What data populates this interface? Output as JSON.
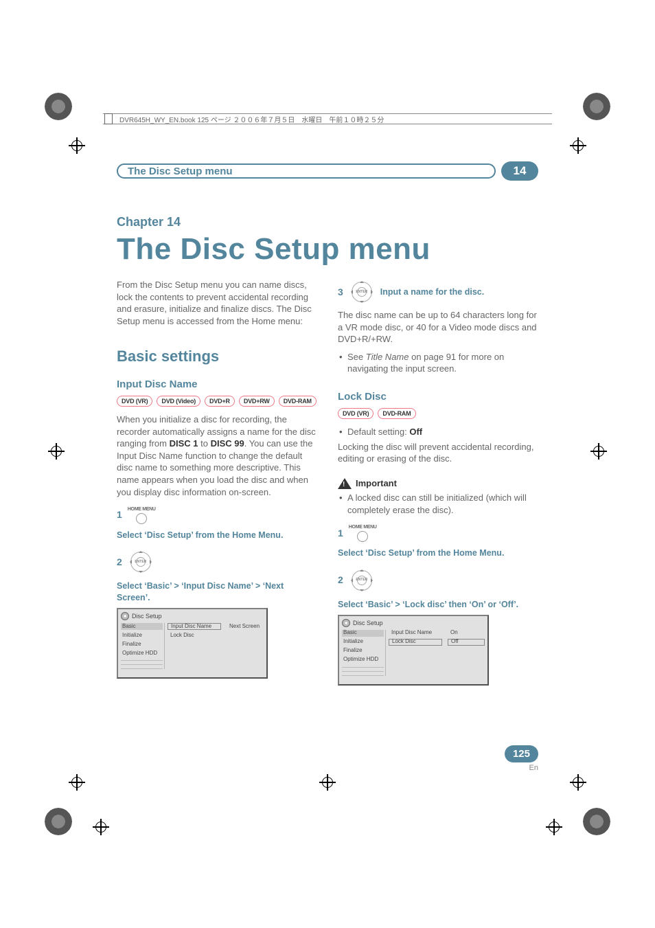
{
  "file_header": "DVR645H_WY_EN.book  125 ページ  ２００６年７月５日　水曜日　午前１０時２５分",
  "running_header": {
    "title": "The Disc Setup menu",
    "chapter_num": "14"
  },
  "chapter": {
    "label": "Chapter 14",
    "title": "The Disc Setup menu"
  },
  "intro": "From the Disc Setup menu you can name discs, lock the contents to prevent accidental recording and erasure, initialize and finalize discs. The Disc Setup menu is accessed from the Home menu:",
  "section_basic": "Basic settings",
  "sub_input_disc": "Input Disc Name",
  "badges_input": [
    "DVD (VR)",
    "DVD (Video)",
    "DVD+R",
    "DVD+RW",
    "DVD-RAM"
  ],
  "input_disc_text_parts": {
    "p1a": "When you initialize a disc for recording, the recorder automatically assigns a name for the disc ranging from ",
    "b1": "DISC 1",
    "p1b": " to ",
    "b2": "DISC 99",
    "p1c": ". You can use the Input Disc Name function to change the default disc name to something more descriptive. This name appears when you load the disc and when you display disc information on-screen."
  },
  "home_menu_label": "HOME MENU",
  "enter_label": "ENTER",
  "step1": {
    "num": "1",
    "text": "Select ‘Disc Setup’ from the Home Menu."
  },
  "step2": {
    "num": "2",
    "text": "Select ‘Basic’ > ‘Input Disc Name’ > ‘Next Screen’."
  },
  "ui1": {
    "title": "Disc Setup",
    "left": [
      "Basic",
      "Initialize",
      "Finalize",
      "Optimize HDD"
    ],
    "mid": [
      "Input Disc Name",
      "Lock Disc"
    ],
    "right": [
      "Next Screen"
    ]
  },
  "step3": {
    "num": "3",
    "text": "Input a name for the disc."
  },
  "step3_body": "The disc name can be up to 64 characters long for a VR mode disc, or 40 for a Video mode discs and DVD+R/+RW.",
  "step3_bullet_parts": {
    "a": "See ",
    "i": "Title Name",
    "b": " on page 91 for more on navigating the input screen."
  },
  "sub_lock": "Lock Disc",
  "badges_lock": [
    "DVD (VR)",
    "DVD-RAM"
  ],
  "lock_default_parts": {
    "a": "Default setting: ",
    "b": "Off"
  },
  "lock_body": "Locking the disc will prevent accidental recording, editing or erasing of the disc.",
  "important_label": "Important",
  "important_bullet": "A locked disc can still be initialized (which will completely erase the disc).",
  "stepL1": {
    "num": "1",
    "text": "Select ‘Disc Setup’ from the Home Menu."
  },
  "stepL2": {
    "num": "2",
    "text": "Select ‘Basic’ > ‘Lock disc’ then ‘On’ or ‘Off’."
  },
  "ui2": {
    "title": "Disc Setup",
    "left": [
      "Basic",
      "Initialize",
      "Finalize",
      "Optimize HDD"
    ],
    "mid": [
      "Input Disc Name",
      "Lock Disc"
    ],
    "right": [
      "On",
      "Off"
    ]
  },
  "footer": {
    "page": "125",
    "lang": "En"
  }
}
